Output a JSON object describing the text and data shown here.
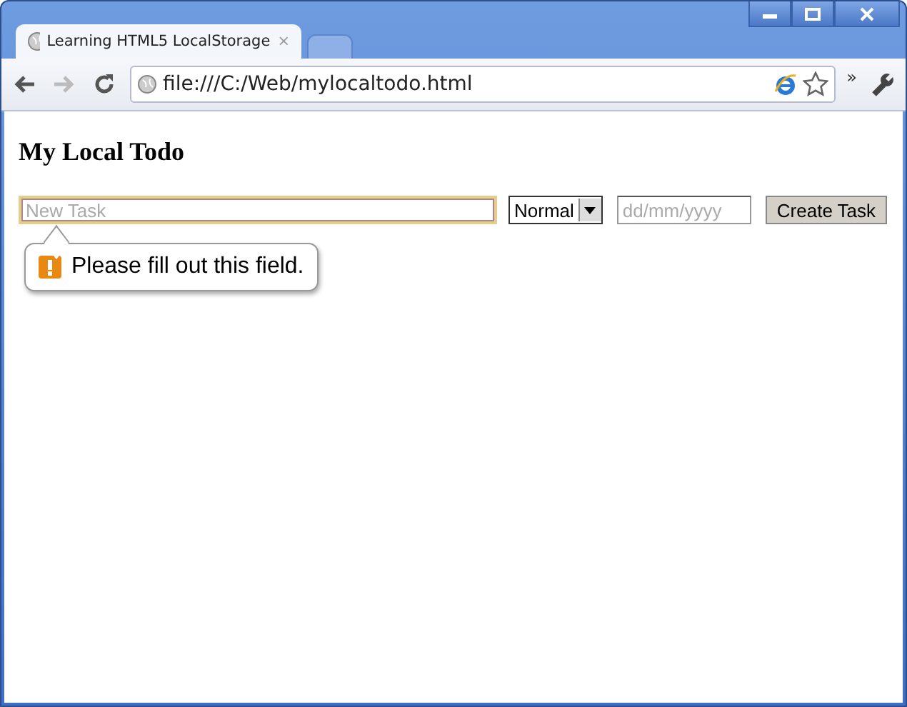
{
  "tabs": [
    {
      "title": "Learning HTML5 LocalStorage",
      "selected": true,
      "close": "×"
    },
    {
      "selected": false
    }
  ],
  "toolbar": {
    "address": "file:///C:/Web/mylocaltodo.html",
    "overflow": "»"
  },
  "page": {
    "heading": "My Local Todo",
    "task_field": {
      "placeholder": "New Task"
    },
    "priority": {
      "value": "Normal"
    },
    "date_field": {
      "placeholder": "dd/mm/yyyy"
    },
    "create_button": "Create Task",
    "validation_message": "Please fill out this field."
  }
}
